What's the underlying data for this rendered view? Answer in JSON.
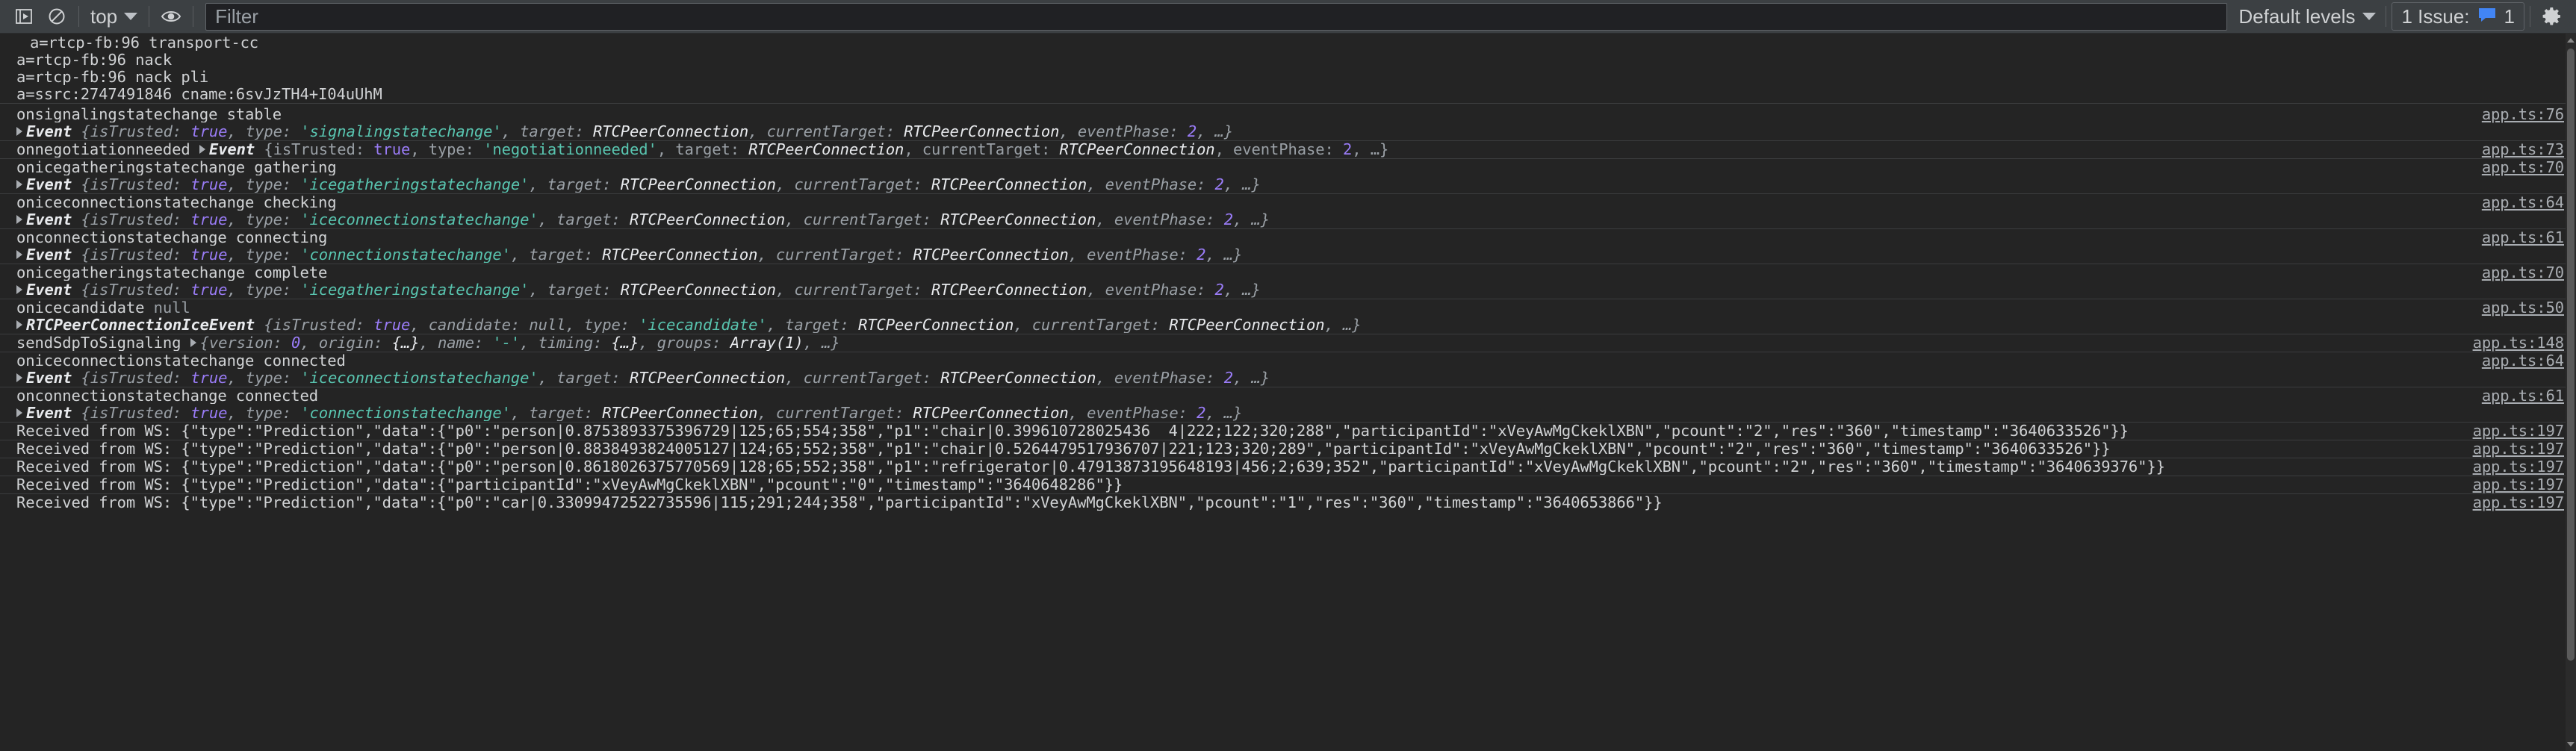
{
  "toolbar": {
    "clear_icon": "clear-console-icon",
    "noop_icon": "no-entry-icon",
    "context_label": "top",
    "eye_icon": "live-expression-icon",
    "filter_placeholder": "Filter",
    "filter_value": "",
    "levels_label": "Default levels",
    "issues_label": "1 Issue:",
    "issues_count": "1",
    "issues_accent": "#4285f4",
    "settings_icon": "gear-icon"
  },
  "rows": [
    {
      "id": "sdp-1",
      "kind": "plain",
      "indent": "deep",
      "text": "a=rtcp-fb:96 transport-cc",
      "source": ""
    },
    {
      "id": "sdp-2",
      "kind": "plain",
      "indent": "normal",
      "text": "a=rtcp-fb:96 nack",
      "source": ""
    },
    {
      "id": "sdp-3",
      "kind": "plain",
      "indent": "normal",
      "text": "a=rtcp-fb:96 nack pli",
      "source": ""
    },
    {
      "id": "sdp-4",
      "kind": "plain",
      "indent": "normal",
      "text": "a=ssrc:2747491846 cname:6svJzTH4+I04uUhM",
      "source": ""
    },
    {
      "id": "sig-head",
      "kind": "head",
      "text": "onsignalingstatechange stable",
      "source": "app.ts:76"
    },
    {
      "id": "sig-evt",
      "kind": "event",
      "ctor": "Event",
      "type_value": "'signalingstatechange'",
      "source": "app.ts:76",
      "tail_visible": false
    },
    {
      "id": "neg-head",
      "kind": "event-inline",
      "label": "onnegotiationneeded",
      "ctor": "Event",
      "type_value": "'negotiationneeded'",
      "source": "app.ts:73"
    },
    {
      "id": "icegath-head",
      "kind": "head",
      "text": "onicegatheringstatechange gathering",
      "source": "app.ts:70"
    },
    {
      "id": "icegath-evt",
      "kind": "event",
      "ctor": "Event",
      "type_value": "'icegatheringstatechange'",
      "source": ""
    },
    {
      "id": "iceconn-head",
      "kind": "head",
      "text": "oniceconnectionstatechange checking",
      "source": "app.ts:64"
    },
    {
      "id": "iceconn-evt",
      "kind": "event",
      "ctor": "Event",
      "type_value": "'iceconnectionstatechange'",
      "source": ""
    },
    {
      "id": "conn-head",
      "kind": "head",
      "text": "onconnectionstatechange connecting",
      "source": "app.ts:61"
    },
    {
      "id": "conn-evt",
      "kind": "event",
      "ctor": "Event",
      "type_value": "'connectionstatechange'",
      "source": ""
    },
    {
      "id": "icegath2-head",
      "kind": "head",
      "text": "onicegatheringstatechange complete",
      "source": "app.ts:70"
    },
    {
      "id": "icegath2-evt",
      "kind": "event",
      "ctor": "Event",
      "type_value": "'icegatheringstatechange'",
      "source": ""
    },
    {
      "id": "icecand-head",
      "kind": "head-null",
      "text": "onicecandidate",
      "null_text": "null",
      "source": "app.ts:50"
    },
    {
      "id": "icecand-evt",
      "kind": "icecandidate-event",
      "ctor": "RTCPeerConnectionIceEvent",
      "type_value": "'icecandidate'",
      "source": ""
    },
    {
      "id": "sendsdp",
      "kind": "sendsdp",
      "label": "sendSdpToSignaling",
      "source": "app.ts:148"
    },
    {
      "id": "iceconn2-head",
      "kind": "head",
      "text": "oniceconnectionstatechange connected",
      "source": "app.ts:64"
    },
    {
      "id": "iceconn2-evt",
      "kind": "event",
      "ctor": "Event",
      "type_value": "'iceconnectionstatechange'",
      "source": ""
    },
    {
      "id": "conn2-head",
      "kind": "head",
      "text": "onconnectionstatechange connected",
      "source": "app.ts:61"
    },
    {
      "id": "conn2-evt",
      "kind": "event",
      "ctor": "Event",
      "type_value": "'connectionstatechange'",
      "source": ""
    },
    {
      "id": "ws-1",
      "kind": "ws",
      "text": "Received from WS: {\"type\":\"Prediction\",\"data\":{\"p0\":\"person|0.8753893375396729|125;65;554;358\",\"p1\":\"chair|0.399610728025436  4|222;122;320;288\",\"participantId\":\"xVeyAwMgCkeklXBN\",\"pcount\":\"2\",\"res\":\"360\",\"timestamp\":\"3640633526\"}}",
      "source": "app.ts:197"
    },
    {
      "id": "ws-2",
      "kind": "ws",
      "text": "Received from WS: {\"type\":\"Prediction\",\"data\":{\"p0\":\"person|0.8838493824005127|124;65;552;358\",\"p1\":\"chair|0.5264479517936707|221;123;320;289\",\"participantId\":\"xVeyAwMgCkeklXBN\",\"pcount\":\"2\",\"res\":\"360\",\"timestamp\":\"3640633526\"}}",
      "source": "app.ts:197"
    },
    {
      "id": "ws-3",
      "kind": "ws",
      "text": "Received from WS: {\"type\":\"Prediction\",\"data\":{\"p0\":\"person|0.8618026375770569|128;65;552;358\",\"p1\":\"refrigerator|0.47913873195648193|456;2;639;352\",\"participantId\":\"xVeyAwMgCkeklXBN\",\"pcount\":\"2\",\"res\":\"360\",\"timestamp\":\"3640639376\"}}",
      "source": "app.ts:197"
    },
    {
      "id": "ws-4",
      "kind": "ws",
      "text": "Received from WS: {\"type\":\"Prediction\",\"data\":{\"participantId\":\"xVeyAwMgCkeklXBN\",\"pcount\":\"0\",\"timestamp\":\"3640648286\"}}",
      "source": "app.ts:197"
    },
    {
      "id": "ws-5",
      "kind": "ws",
      "text": "Received from WS: {\"type\":\"Prediction\",\"data\":{\"p0\":\"car|0.33099472522735596|115;291;244;358\",\"participantId\":\"xVeyAwMgCkeklXBN\",\"pcount\":\"1\",\"res\":\"360\",\"timestamp\":\"3640653866\"}}",
      "source": "app.ts:197"
    }
  ],
  "event_common": {
    "brace_open": "{",
    "is_trusted_key": "isTrusted",
    "is_trusted_value": "true",
    "type_key": "type",
    "target_key": "target",
    "target_value": "RTCPeerConnection",
    "current_target_key": "currentTarget",
    "current_target_value": "RTCPeerConnection",
    "event_phase_key": "eventPhase",
    "event_phase_value": "2",
    "ellipsis": "…",
    "brace_close": "}",
    "candidate_key": "candidate",
    "candidate_value": "null"
  },
  "sendsdp_object": {
    "version_key": "version",
    "version_value": "0",
    "origin_key": "origin",
    "origin_value": "{…}",
    "name_key": "name",
    "name_value": "'-'",
    "timing_key": "timing",
    "timing_value": "{…}",
    "groups_key": "groups",
    "groups_value": "Array(1)",
    "ellipsis": "…"
  }
}
